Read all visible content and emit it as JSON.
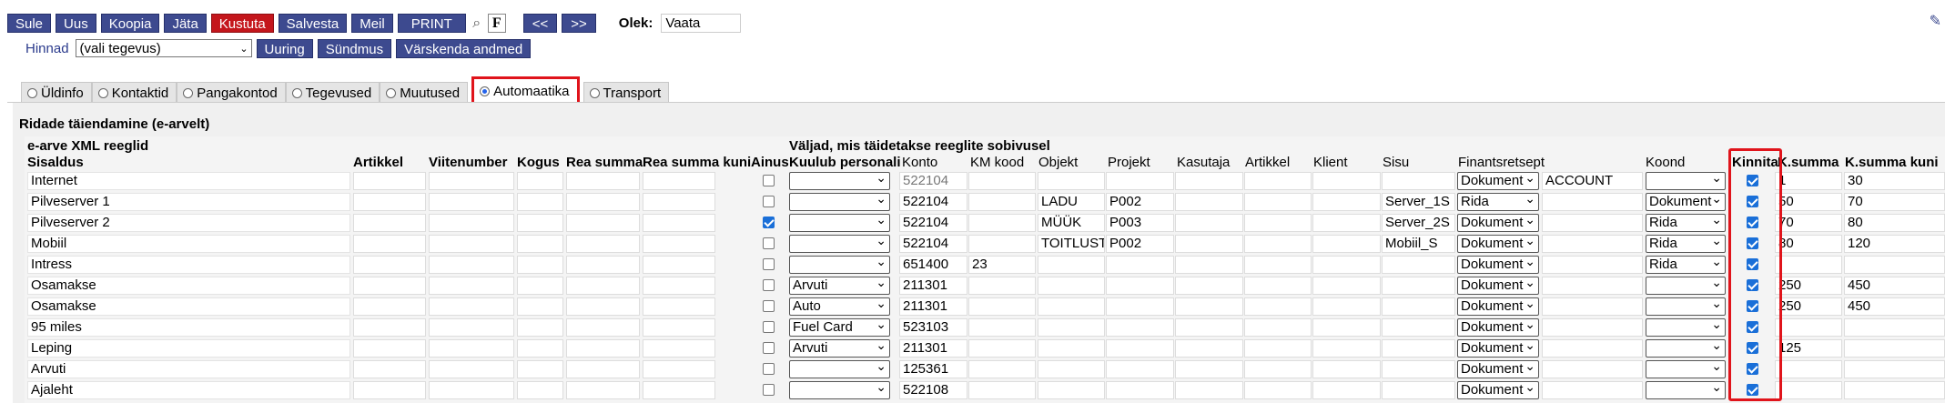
{
  "toolbar": {
    "buttons": [
      "Sule",
      "Uus",
      "Koopia",
      "Jäta",
      "Kustuta",
      "Salvesta",
      "Meil",
      "PRINT"
    ],
    "bold_f": "F",
    "prev": "<<",
    "next": ">>",
    "olek_label": "Olek:",
    "olek_value": "Vaata"
  },
  "row2": {
    "hinnad_label": "Hinnad",
    "hinnad_select": "(vali tegevus)",
    "buttons": [
      "Uuring",
      "Sündmus",
      "Värskenda andmed"
    ]
  },
  "tabs": [
    {
      "label": "Üldinfo",
      "active": false
    },
    {
      "label": "Kontaktid",
      "active": false
    },
    {
      "label": "Pangakontod",
      "active": false
    },
    {
      "label": "Tegevused",
      "active": false
    },
    {
      "label": "Muutused",
      "active": false
    },
    {
      "label": "Automaatika",
      "active": true
    },
    {
      "label": "Transport",
      "active": false
    }
  ],
  "section_title": "Ridade täiendamine (e-arvelt)",
  "group_left": "e-arve XML reeglid",
  "group_right": "Väljad, mis täidetakse reeglite sobivusel",
  "headers": {
    "sisaldus": "Sisaldus",
    "artikkel": "Artikkel",
    "viitenumber": "Viitenumber",
    "kogus": "Kogus",
    "rea_summa": "Rea summa",
    "rea_summa_kuni": "Rea summa kuni",
    "ainus": "Ainus",
    "kuulub": "Kuulub personali",
    "konto": "Konto",
    "km_kood": "KM kood",
    "objekt": "Objekt",
    "projekt": "Projekt",
    "kasutaja": "Kasutaja",
    "artikkel2": "Artikkel",
    "klient": "Klient",
    "sisu": "Sisu",
    "finants": "Finantsretsept",
    "koond": "Koond",
    "kinnita": "Kinnita",
    "ksumma": "K.summa",
    "ksumma_kuni": "K.summa kuni"
  },
  "rows": [
    {
      "sisaldus": "Internet",
      "ainus": false,
      "kuulub": "",
      "konto": "522104",
      "konto_gray": true,
      "km": "",
      "objekt": "",
      "projekt": "",
      "sisu": "",
      "finants": "Dokument",
      "finants_text": "ACCOUNT",
      "koond": "",
      "kinnita": true,
      "ksumma": "1",
      "ksumma_kuni": "30"
    },
    {
      "sisaldus": "Pilveserver 1",
      "ainus": false,
      "kuulub": "",
      "konto": "522104",
      "konto_gray": false,
      "km": "",
      "objekt": "LADU",
      "projekt": "P002",
      "sisu": "Server_1S",
      "finants": "Rida",
      "finants_text": "",
      "koond": "Dokument",
      "kinnita": true,
      "ksumma": "50",
      "ksumma_kuni": "70"
    },
    {
      "sisaldus": "Pilveserver 2",
      "ainus": true,
      "kuulub": "",
      "konto": "522104",
      "konto_gray": false,
      "km": "",
      "objekt": "MÜÜK",
      "projekt": "P003",
      "sisu": "Server_2S",
      "finants": "Dokument",
      "finants_text": "",
      "koond": "Rida",
      "kinnita": true,
      "ksumma": "70",
      "ksumma_kuni": "80"
    },
    {
      "sisaldus": "Mobiil",
      "ainus": false,
      "kuulub": "",
      "konto": "522104",
      "konto_gray": false,
      "km": "",
      "objekt": "TOITLUST",
      "projekt": "P002",
      "sisu": "Mobiil_S",
      "finants": "Dokument",
      "finants_text": "",
      "koond": "Rida",
      "kinnita": true,
      "ksumma": "80",
      "ksumma_kuni": "120"
    },
    {
      "sisaldus": "Intress",
      "ainus": false,
      "kuulub": "",
      "konto": "651400",
      "konto_gray": false,
      "km": "23",
      "objekt": "",
      "projekt": "",
      "sisu": "",
      "finants": "Dokument",
      "finants_text": "",
      "koond": "Rida",
      "kinnita": true,
      "ksumma": "",
      "ksumma_kuni": ""
    },
    {
      "sisaldus": "Osamakse",
      "ainus": false,
      "kuulub": "Arvuti",
      "konto": "211301",
      "konto_gray": false,
      "km": "",
      "objekt": "",
      "projekt": "",
      "sisu": "",
      "finants": "Dokument",
      "finants_text": "",
      "koond": "",
      "kinnita": true,
      "ksumma": "250",
      "ksumma_kuni": "450"
    },
    {
      "sisaldus": "Osamakse",
      "ainus": false,
      "kuulub": "Auto",
      "konto": "211301",
      "konto_gray": false,
      "km": "",
      "objekt": "",
      "projekt": "",
      "sisu": "",
      "finants": "Dokument",
      "finants_text": "",
      "koond": "",
      "kinnita": true,
      "ksumma": "250",
      "ksumma_kuni": "450"
    },
    {
      "sisaldus": "95 miles",
      "ainus": false,
      "kuulub": "Fuel Card",
      "konto": "523103",
      "konto_gray": false,
      "km": "",
      "objekt": "",
      "projekt": "",
      "sisu": "",
      "finants": "Dokument",
      "finants_text": "",
      "koond": "",
      "kinnita": true,
      "ksumma": "",
      "ksumma_kuni": ""
    },
    {
      "sisaldus": "Leping",
      "ainus": false,
      "kuulub": "Arvuti",
      "konto": "211301",
      "konto_gray": false,
      "km": "",
      "objekt": "",
      "projekt": "",
      "sisu": "",
      "finants": "Dokument",
      "finants_text": "",
      "koond": "",
      "kinnita": true,
      "ksumma": "125",
      "ksumma_kuni": ""
    },
    {
      "sisaldus": "Arvuti",
      "ainus": false,
      "kuulub": "",
      "konto": "125361",
      "konto_gray": false,
      "km": "",
      "objekt": "",
      "projekt": "",
      "sisu": "",
      "finants": "Dokument",
      "finants_text": "",
      "koond": "",
      "kinnita": true,
      "ksumma": "",
      "ksumma_kuni": ""
    },
    {
      "sisaldus": "Ajaleht",
      "ainus": false,
      "kuulub": "",
      "konto": "522108",
      "konto_gray": false,
      "km": "",
      "objekt": "",
      "projekt": "",
      "sisu": "",
      "finants": "Dokument",
      "finants_text": "",
      "koond": "",
      "kinnita": true,
      "ksumma": "",
      "ksumma_kuni": ""
    }
  ],
  "colors": {
    "button": "#3d4a8f",
    "danger": "#c4161c",
    "highlight": "#e0141b",
    "check": "#1a6fd8"
  }
}
